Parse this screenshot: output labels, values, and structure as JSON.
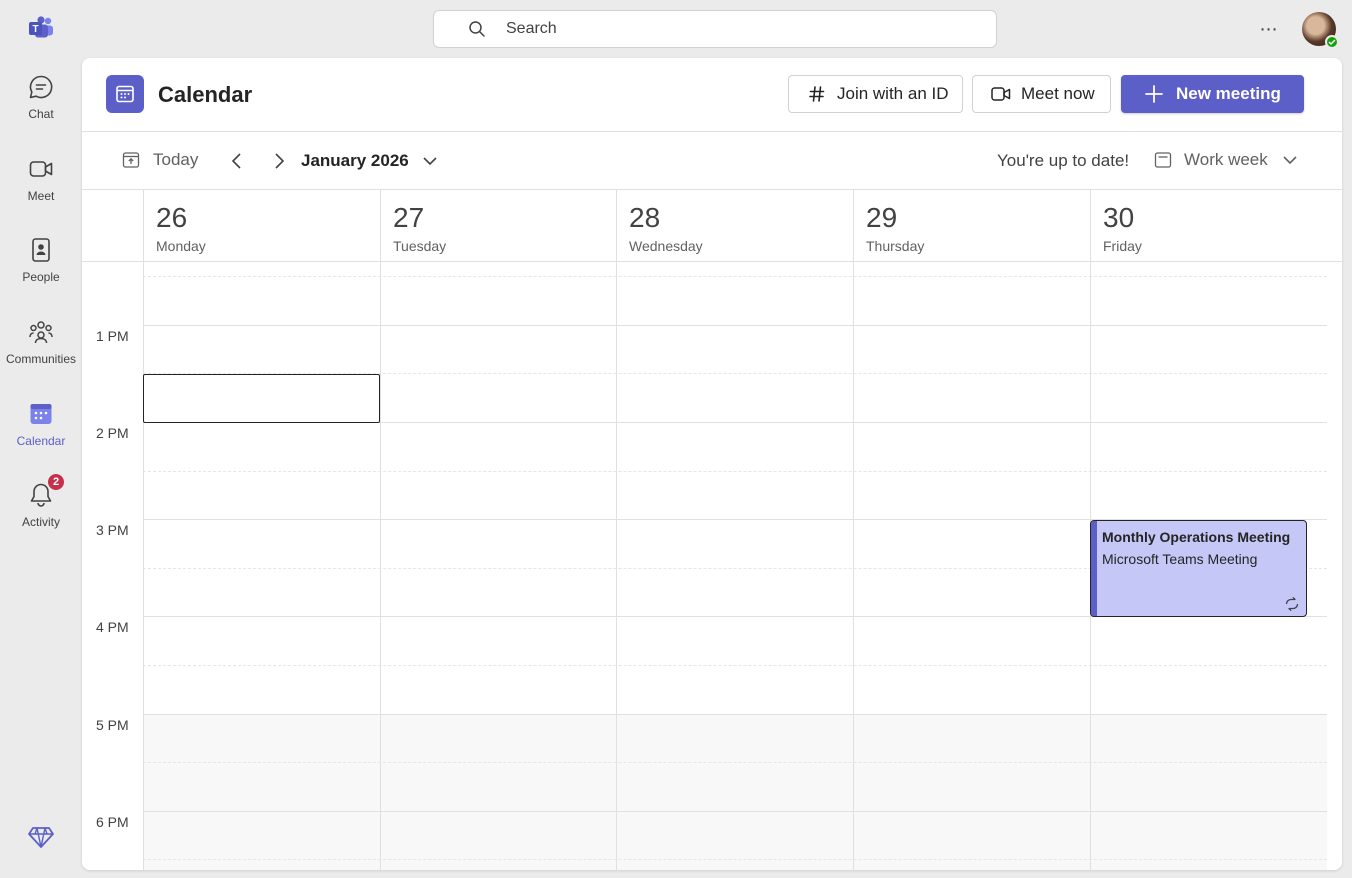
{
  "rail": {
    "items": [
      {
        "label": "Chat",
        "icon": "chat-icon"
      },
      {
        "label": "Meet",
        "icon": "video-icon"
      },
      {
        "label": "People",
        "icon": "contact-book-icon"
      },
      {
        "label": "Communities",
        "icon": "people-community-icon"
      },
      {
        "label": "Calendar",
        "icon": "calendar-icon",
        "active": true
      },
      {
        "label": "Activity",
        "icon": "bell-icon",
        "badge": "2"
      }
    ]
  },
  "search": {
    "placeholder": "Search"
  },
  "header": {
    "title": "Calendar",
    "join_label": "Join with an ID",
    "meet_label": "Meet now",
    "new_label": "New meeting"
  },
  "toolbar": {
    "today_label": "Today",
    "month_label": "January 2026",
    "status": "You're up to date!",
    "view_label": "Work week"
  },
  "days": [
    {
      "num": "26",
      "name": "Monday"
    },
    {
      "num": "27",
      "name": "Tuesday"
    },
    {
      "num": "28",
      "name": "Wednesday"
    },
    {
      "num": "29",
      "name": "Thursday"
    },
    {
      "num": "30",
      "name": "Friday"
    }
  ],
  "times": [
    "1 PM",
    "2 PM",
    "3 PM",
    "4 PM",
    "5 PM",
    "6 PM"
  ],
  "event": {
    "title": "Monthly Operations Meeting",
    "subtitle": "Microsoft Teams Meeting",
    "day": "Friday",
    "recurring": true
  },
  "colors": {
    "accent": "#5b5fc7",
    "event_fill": "#c5c8f7",
    "badge": "#c4314b",
    "presence": "#13a10e"
  }
}
